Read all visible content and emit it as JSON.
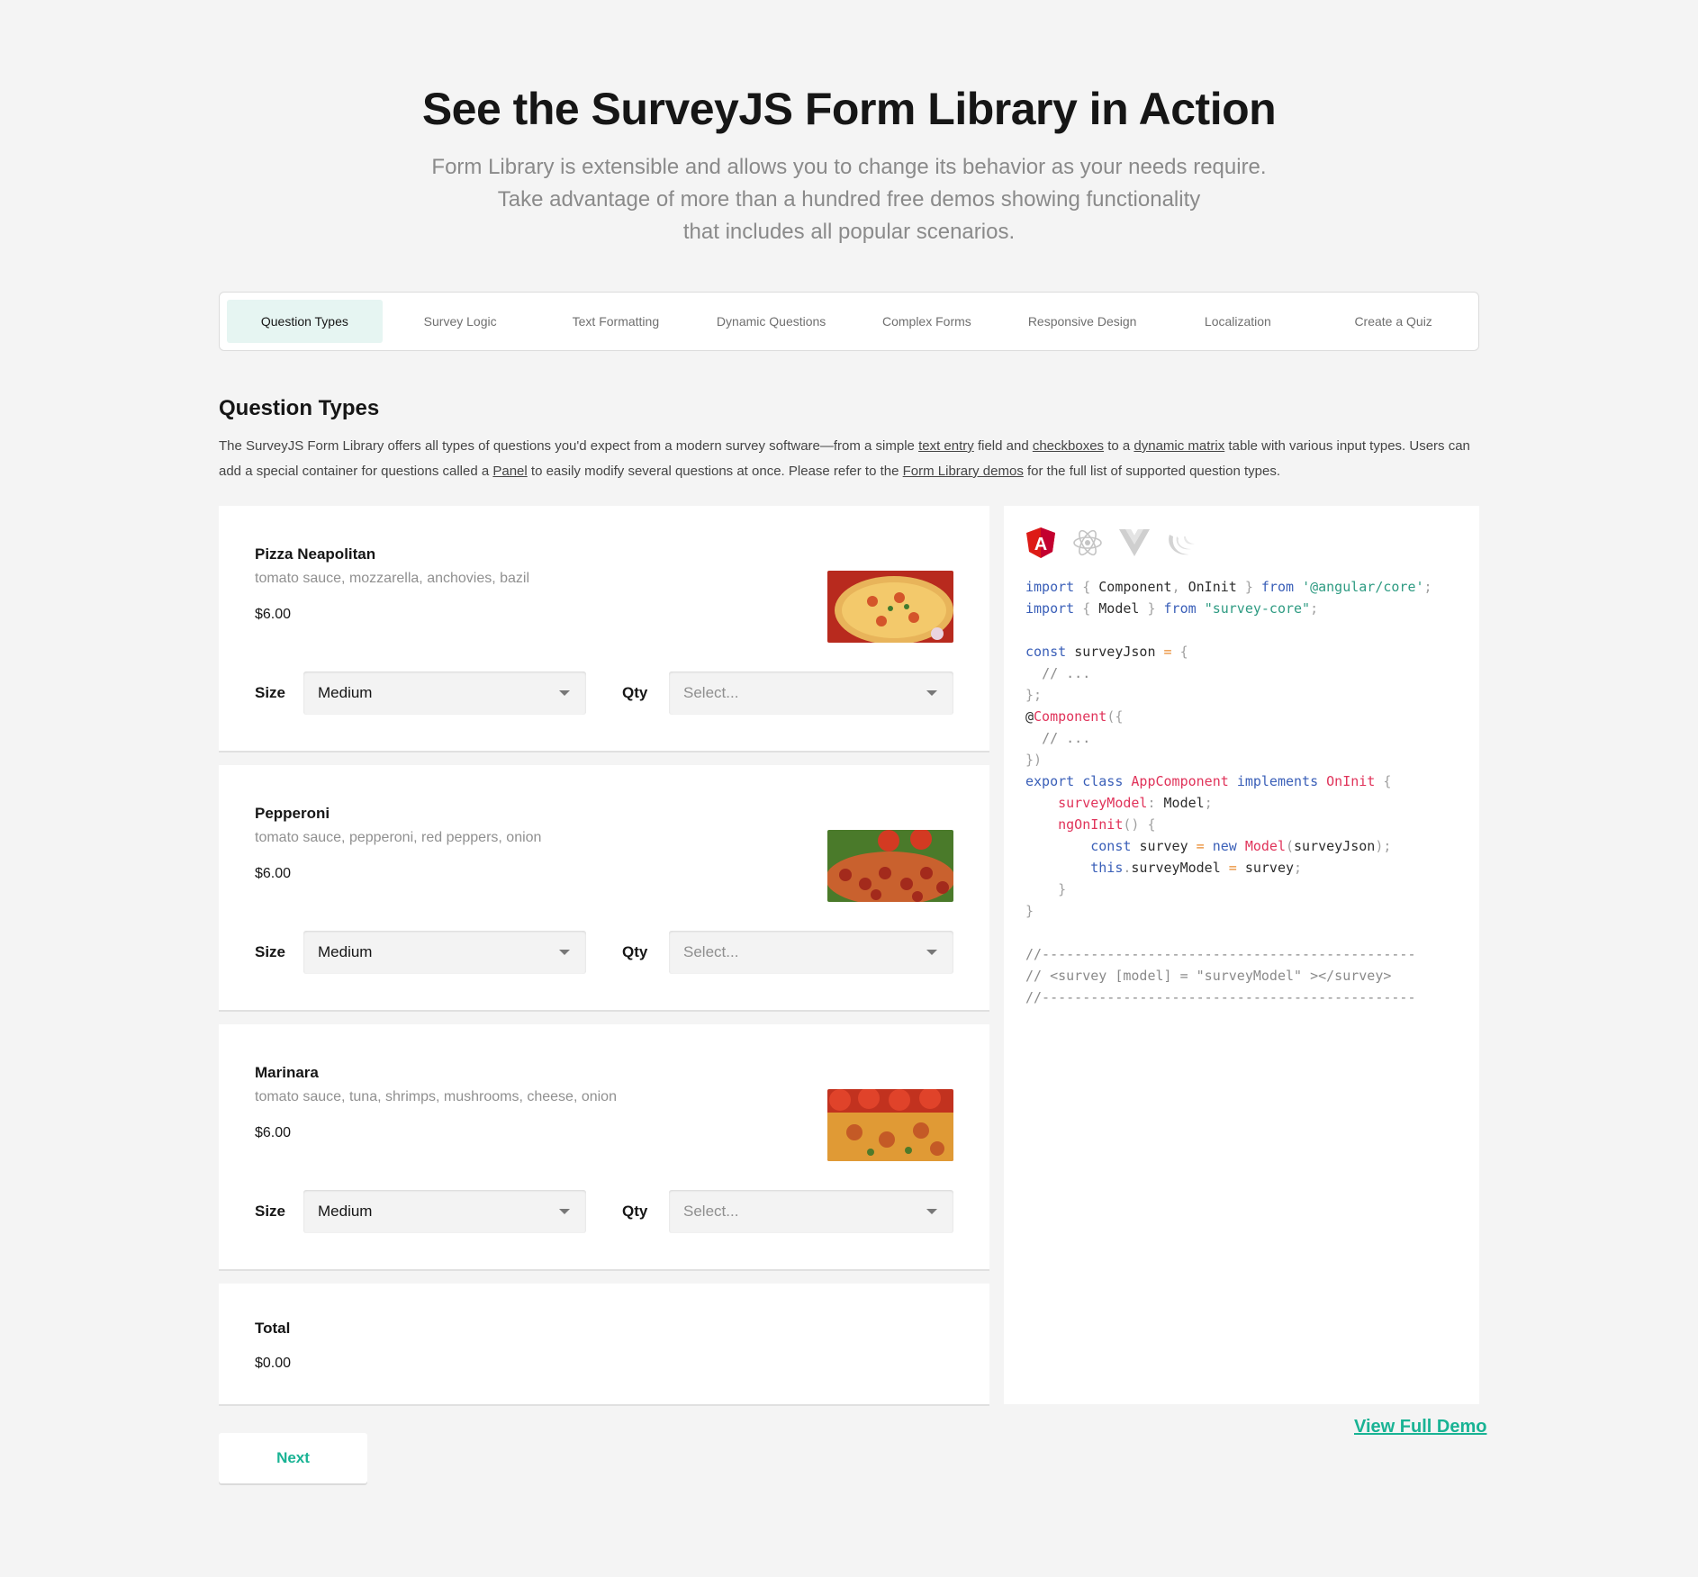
{
  "hero": {
    "title": "See the SurveyJS Form Library in Action",
    "subtitle_line1": "Form Library is extensible and allows you to change its behavior as your needs require.",
    "subtitle_line2": "Take advantage of more than a hundred free demos showing functionality",
    "subtitle_line3": "that includes all popular scenarios."
  },
  "tabs": [
    {
      "label": "Question Types",
      "active": true
    },
    {
      "label": "Survey Logic",
      "active": false
    },
    {
      "label": "Text Formatting",
      "active": false
    },
    {
      "label": "Dynamic Questions",
      "active": false
    },
    {
      "label": "Complex Forms",
      "active": false
    },
    {
      "label": "Responsive Design",
      "active": false
    },
    {
      "label": "Localization",
      "active": false
    },
    {
      "label": "Create a Quiz",
      "active": false
    }
  ],
  "section": {
    "title": "Question Types",
    "desc_part1": "The SurveyJS Form Library offers all types of questions you'd expect from a modern survey software—from a simple ",
    "link_text_entry": "text entry",
    "desc_part2": " field and ",
    "link_checkboxes": "checkboxes",
    "desc_part3": " to a ",
    "link_dynamic_matrix": "dynamic matrix",
    "desc_part4": " table with various input types. Users can add a special container for questions called a ",
    "link_panel": "Panel",
    "desc_part5": " to easily modify several questions at once. Please refer to the ",
    "link_demos": "Form Library demos",
    "desc_part6": " for the full list of supported question types."
  },
  "items": [
    {
      "name": "Pizza Neapolitan",
      "desc": "tomato sauce, mozzarella, anchovies, bazil",
      "price": "$6.00",
      "size_label": "Size",
      "size_value": "Medium",
      "qty_label": "Qty",
      "qty_placeholder": "Select..."
    },
    {
      "name": "Pepperoni",
      "desc": "tomato sauce, pepperoni, red peppers, onion",
      "price": "$6.00",
      "size_label": "Size",
      "size_value": "Medium",
      "qty_label": "Qty",
      "qty_placeholder": "Select..."
    },
    {
      "name": "Marinara",
      "desc": "tomato sauce, tuna, shrimps, mushrooms, cheese, onion",
      "price": "$6.00",
      "size_label": "Size",
      "size_value": "Medium",
      "qty_label": "Qty",
      "qty_placeholder": "Select..."
    }
  ],
  "total": {
    "label": "Total",
    "value": "$0.00"
  },
  "code": {
    "framework_icons": [
      "angular-icon",
      "react-icon",
      "vue-icon",
      "jquery-icon"
    ],
    "l1a": "import",
    "l1b": "Component",
    "l1c": "OnInit",
    "l1d": "from",
    "l1e": "'@angular/core'",
    "l2a": "import",
    "l2b": "Model",
    "l2c": "from",
    "l2d": "\"survey-core\"",
    "l3a": "const",
    "l3b": "surveyJson",
    "l4": "// ...",
    "l6b": "Component",
    "l7": "// ...",
    "l9a": "export",
    "l9b": "class",
    "l9c": "AppComponent",
    "l9d": "implements",
    "l9e": "OnInit",
    "l10a": "surveyModel",
    "l10b": "Model",
    "l11a": "ngOnInit",
    "l12a": "const",
    "l12b": "survey",
    "l12c": "new",
    "l12d": "Model",
    "l12e": "surveyJson",
    "l13a": "this",
    "l13b": "surveyModel",
    "l13c": "survey",
    "c1": "//----------------------------------------------",
    "c2": "// <survey [model] = \"surveyModel\" ></survey>",
    "c3": "//----------------------------------------------"
  },
  "actions": {
    "view_full_demo": "View Full Demo",
    "next": "Next"
  },
  "colors": {
    "accent": "#19b394",
    "active_tab_bg": "#e6f5f2"
  }
}
